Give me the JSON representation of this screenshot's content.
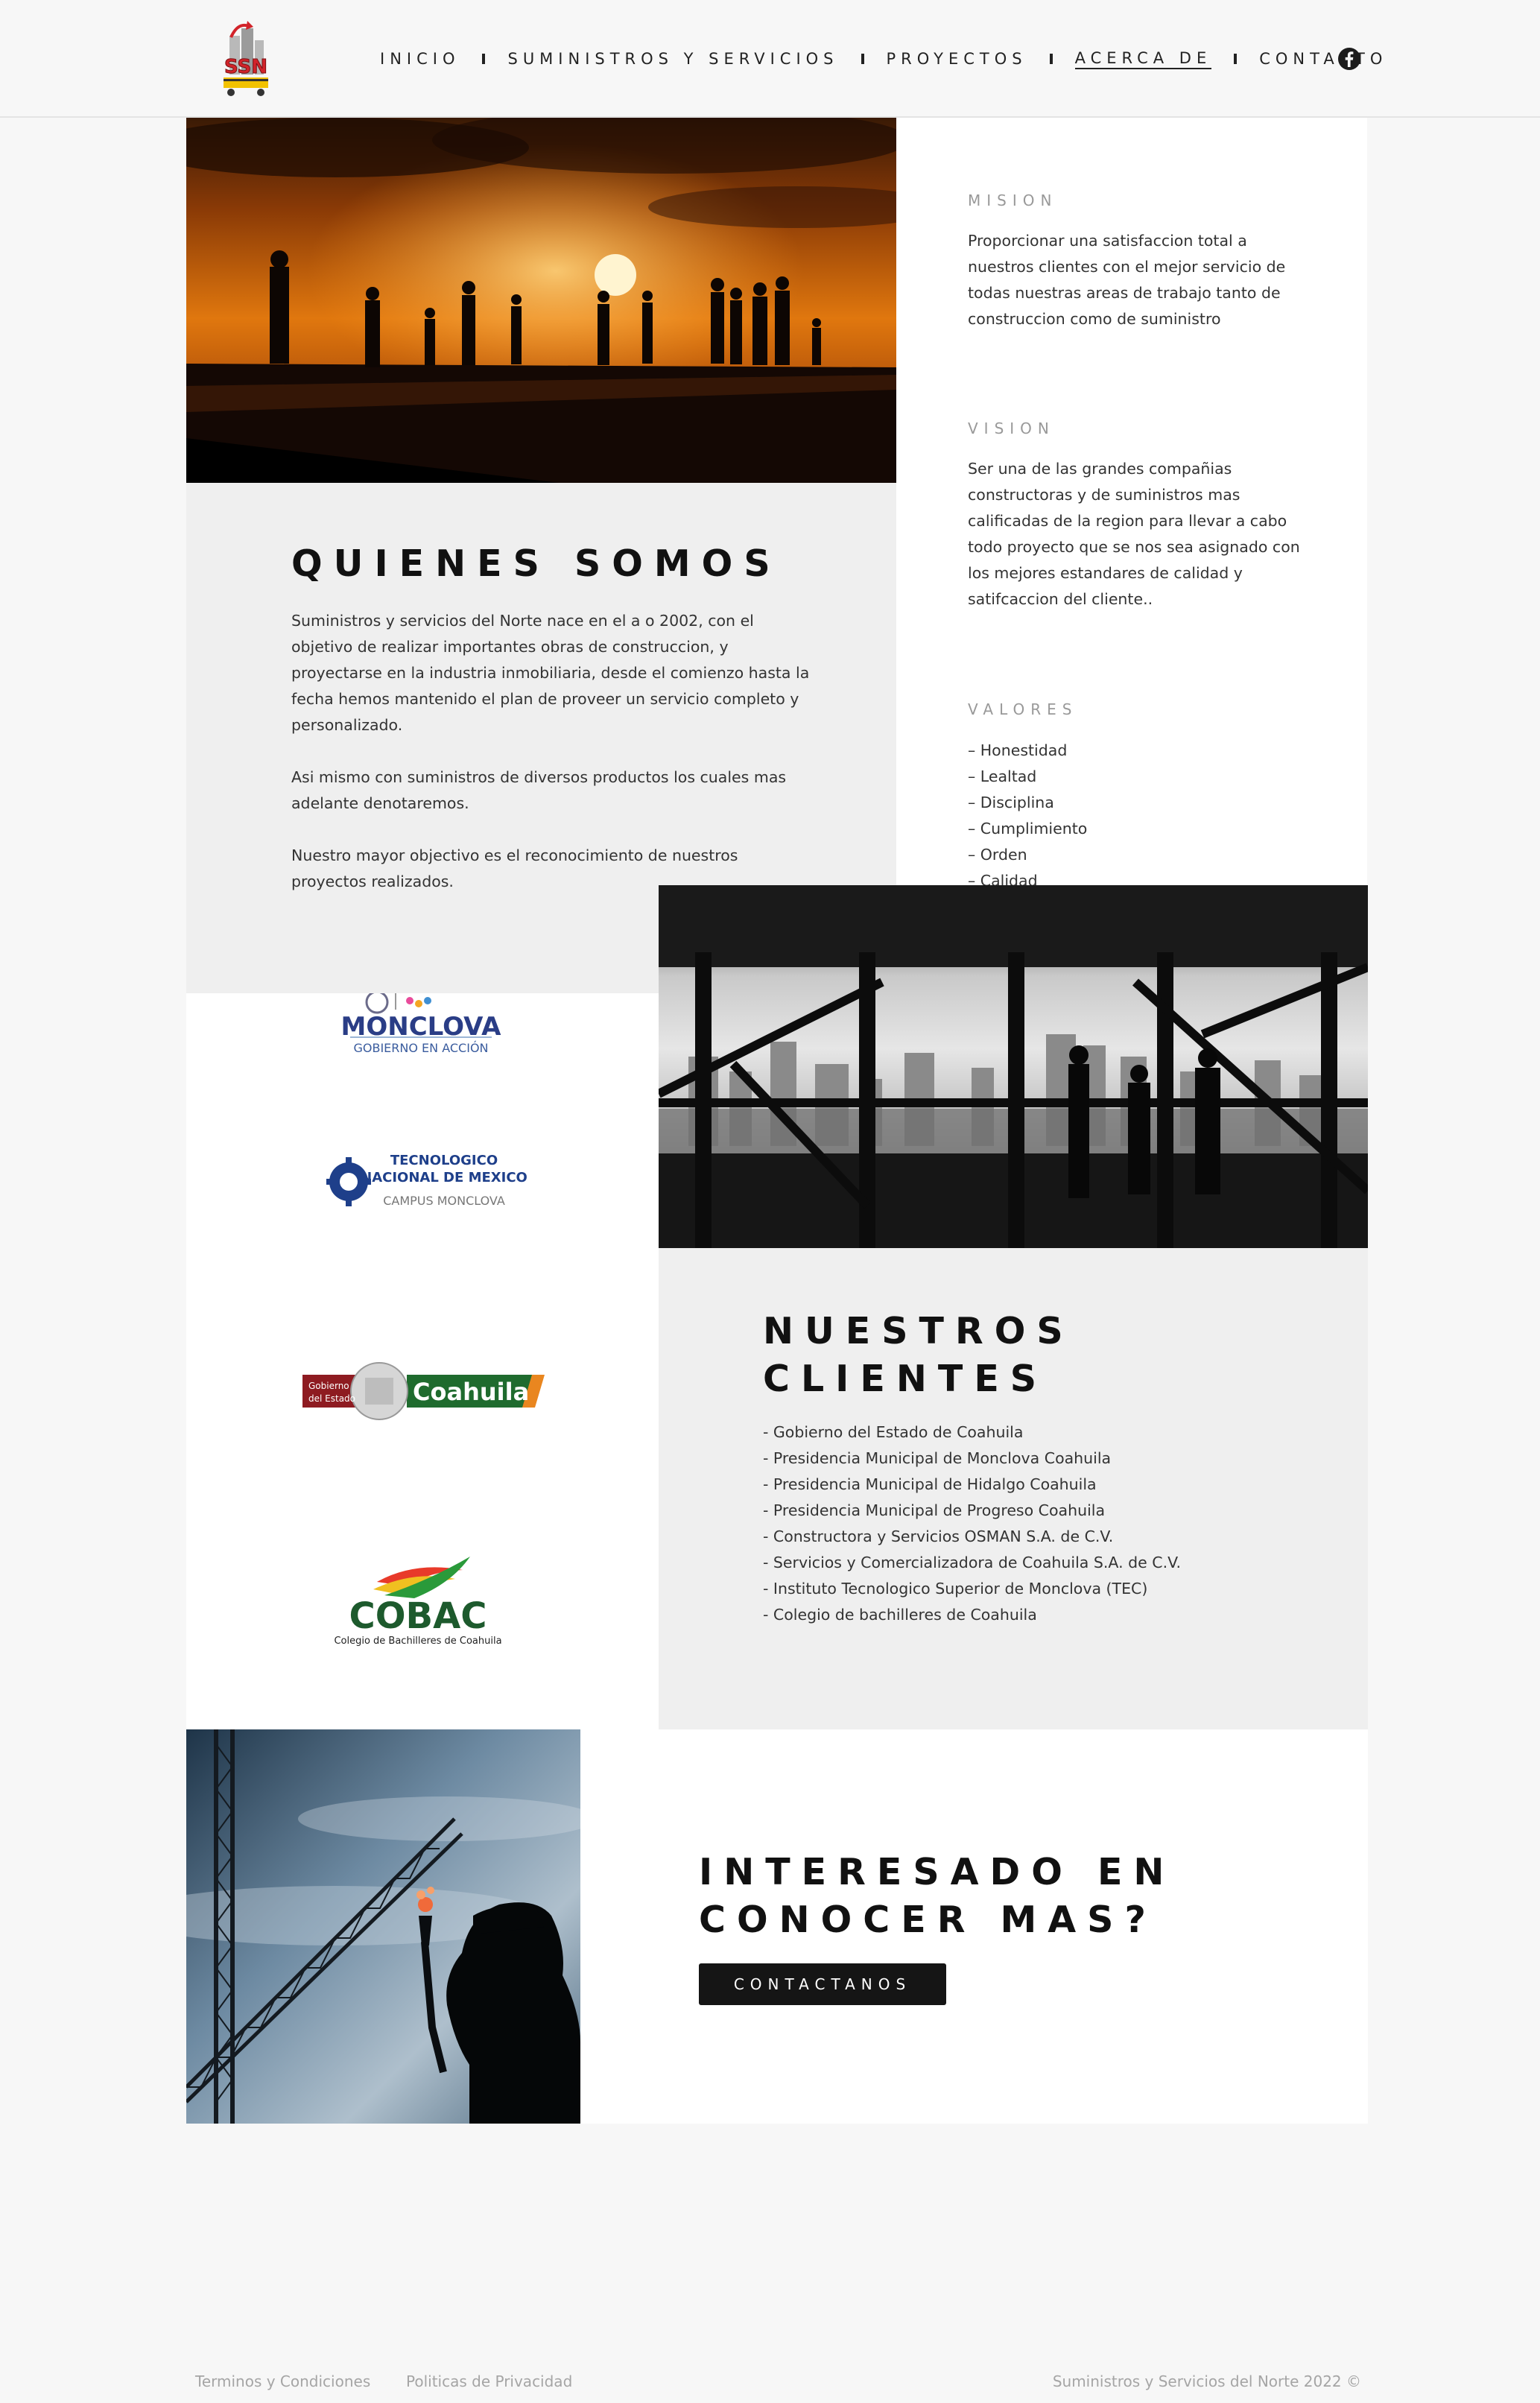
{
  "header": {
    "logo_text": "SSN",
    "nav": [
      {
        "label": "INICIO"
      },
      {
        "label": "SUMINISTROS Y SERVICIOS"
      },
      {
        "label": "PROYECTOS"
      },
      {
        "label": "ACERCA DE",
        "active": true
      },
      {
        "label": "CONTACTO"
      }
    ],
    "social_icon": "facebook-icon"
  },
  "about": {
    "title": "QUIENES SOMOS",
    "paragraphs": [
      "Suministros y servicios del Norte nace en el a  o 2002, con el objetivo de realizar importantes obras de construccion, y proyectarse en la industria inmobiliaria, desde el comienzo hasta la fecha hemos mantenido el plan de proveer un servicio completo y personalizado.",
      "Asi mismo con suministros de diversos productos los cuales mas adelante denotaremos.",
      "Nuestro mayor objectivo es el reconocimiento de nuestros proyectos realizados."
    ]
  },
  "mision": {
    "label": "MISION",
    "text": "Proporcionar una satisfaccion total a nuestros clientes con el mejor servicio de todas nuestras areas de trabajo tanto de construccion como de suministro"
  },
  "vision": {
    "label": "VISION",
    "text": "Ser una de las grandes compañias constructoras y de suministros mas calificadas de la region para llevar a cabo todo proyecto que se nos sea asignado con los mejores estandares de calidad y satifcaccion del cliente.."
  },
  "valores": {
    "label": "VALORES",
    "items": [
      "– Honestidad",
      "– Lealtad",
      "– Disciplina",
      "– Cumplimiento",
      "– Orden",
      "– Calidad"
    ]
  },
  "client_logos": {
    "monclova": {
      "name": "MONCLOVA",
      "sub": "GOBIERNO EN ACCIÓN"
    },
    "tec": {
      "line1": "TECNOLOGICO",
      "line2": "NACIONAL DE MEXICO",
      "line3": "CAMPUS MONCLOVA"
    },
    "coahuila": {
      "small1": "Gobierno",
      "small2": "del Estado",
      "name": "Coahuila"
    },
    "cobac": {
      "name": "COBAC",
      "sub": "Colegio de Bachilleres de Coahuila"
    }
  },
  "clients": {
    "title_line1": "NUESTROS",
    "title_line2": "CLIENTES",
    "items": [
      "- Gobierno del Estado de Coahuila",
      "- Presidencia Municipal de Monclova Coahuila",
      "- Presidencia Municipal de Hidalgo Coahuila",
      "- Presidencia Municipal de Progreso Coahuila",
      "- Constructora y Servicios OSMAN S.A. de C.V.",
      "- Servicios y Comercializadora de Coahuila S.A. de C.V.",
      "- Instituto Tecnologico Superior de Monclova (TEC)",
      "- Colegio de bachilleres de Coahuila"
    ]
  },
  "cta": {
    "title_line1": "INTERESADO EN",
    "title_line2": "CONOCER MAS?",
    "button": "CONTACTANOS"
  },
  "footer": {
    "terms": "Terminos y Condiciones",
    "privacy": "Politicas de Privacidad",
    "copyright": "Suministros y Servicios del Norte 2022 ©"
  },
  "colors": {
    "background": "#f7f7f7",
    "panel_gray": "#efefef",
    "panel_white": "#ffffff",
    "text_dark": "#111111",
    "button": "#151515",
    "muted": "#a5a5a5"
  }
}
